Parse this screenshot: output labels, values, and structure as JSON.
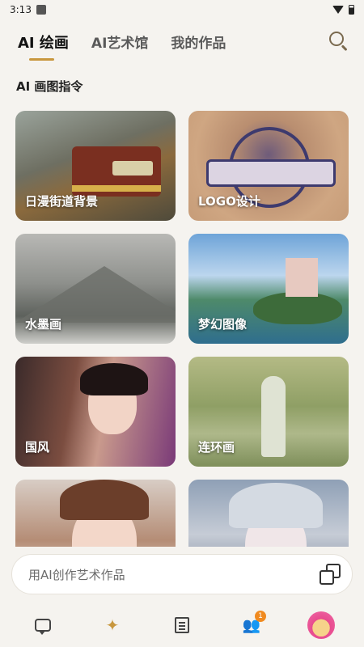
{
  "status_bar": {
    "time": "3:13"
  },
  "header": {
    "tabs": [
      {
        "label": "AI 绘画",
        "active": true
      },
      {
        "label": "AI艺术馆",
        "active": false
      },
      {
        "label": "我的作品",
        "active": false
      }
    ],
    "search_icon": "search-icon"
  },
  "section": {
    "title": "AI 画图指令"
  },
  "cards": [
    {
      "label": "日漫街道背景"
    },
    {
      "label": "LOGO设计"
    },
    {
      "label": "水墨画"
    },
    {
      "label": "梦幻图像"
    },
    {
      "label": "国风"
    },
    {
      "label": "连环画"
    },
    {
      "label": ""
    },
    {
      "label": ""
    }
  ],
  "composer": {
    "placeholder": "用AI创作艺术作品",
    "icon": "gallery-icon"
  },
  "bottom_nav": {
    "items": [
      {
        "icon": "chat-icon"
      },
      {
        "icon": "magic-wand-icon",
        "active": true
      },
      {
        "icon": "news-icon"
      },
      {
        "icon": "people-icon",
        "badge": "1"
      },
      {
        "icon": "avatar"
      }
    ]
  },
  "colors": {
    "accent": "#c8973e",
    "badge": "#f08a1f",
    "background": "#f5f3ef"
  }
}
